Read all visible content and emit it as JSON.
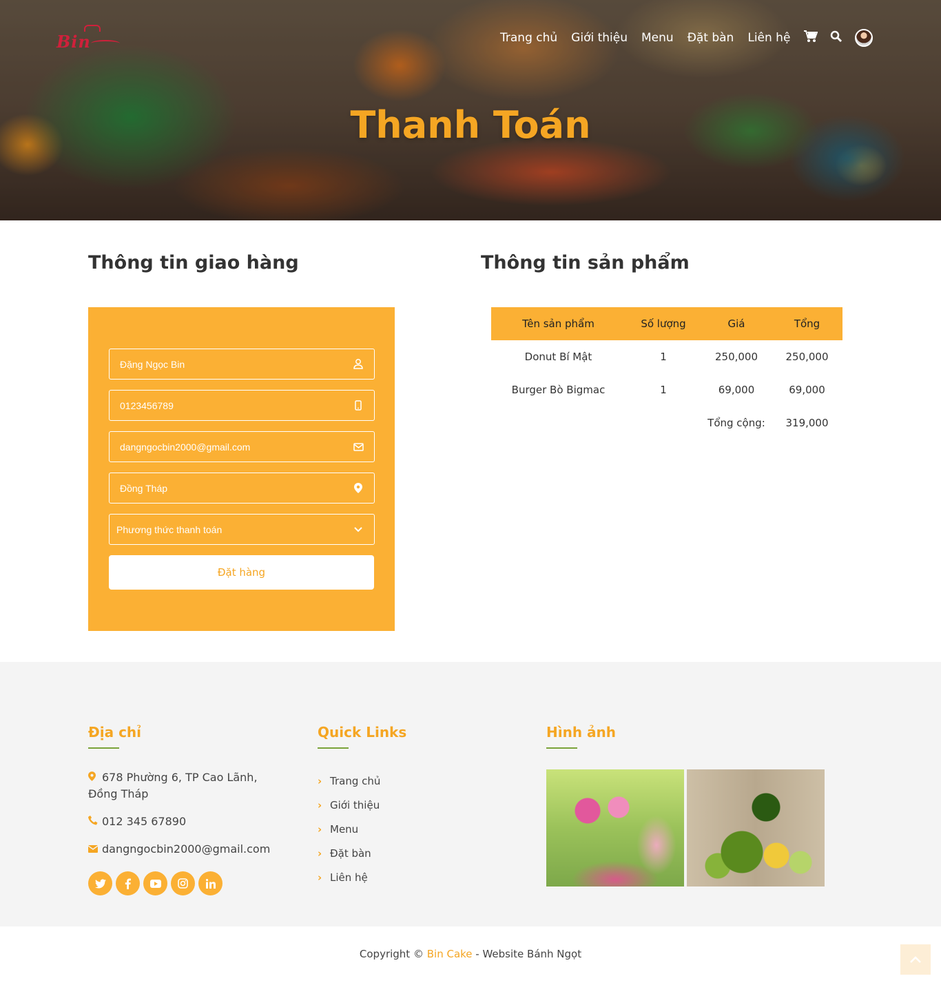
{
  "header": {
    "logo_text": "Bin",
    "nav": [
      "Trang chủ",
      "Giới thiệu",
      "Menu",
      "Đặt bàn",
      "Liên hệ"
    ],
    "icons": [
      "cart-icon",
      "search-icon",
      "avatar"
    ]
  },
  "hero": {
    "title": "Thanh Toán"
  },
  "shipping": {
    "title": "Thông tin giao hàng",
    "fields": {
      "name": "Đặng Ngọc Bin",
      "phone": "0123456789",
      "email": "dangngocbin2000@gmail.com",
      "address": "Đồng Tháp",
      "payment": "Phương thức thanh toán"
    },
    "submit_label": "Đặt hàng"
  },
  "products": {
    "title": "Thông tin sản phẩm",
    "headers": [
      "Tên sản phẩm",
      "Số lượng",
      "Giá",
      "Tổng"
    ],
    "rows": [
      [
        "Donut Bí Mật",
        "1",
        "250,000",
        "250,000"
      ],
      [
        "Burger Bò Bigmac",
        "1",
        "69,000",
        "69,000"
      ]
    ],
    "total_label": "Tổng cộng:",
    "total_value": "319,000"
  },
  "footer": {
    "address_title": "Địa chỉ",
    "address": "678 Phường 6, TP Cao Lãnh, Đồng Tháp",
    "phone": "012 345 67890",
    "email": "dangngocbin2000@gmail.com",
    "quick_links_title": "Quick Links",
    "quick_links": [
      "Trang chủ",
      "Giới thiệu",
      "Menu",
      "Đặt bàn",
      "Liên hệ"
    ],
    "gallery_title": "Hình ảnh",
    "socials": [
      "twitter-icon",
      "facebook-icon",
      "youtube-icon",
      "instagram-icon",
      "linkedin-icon"
    ]
  },
  "copyright": {
    "prefix": "Copyright © ",
    "brand": "Bin Cake",
    "suffix": " - Website Bánh Ngọt"
  },
  "colors": {
    "accent": "#fbb034",
    "title": "#f5a623",
    "underline": "#7aa33a"
  }
}
